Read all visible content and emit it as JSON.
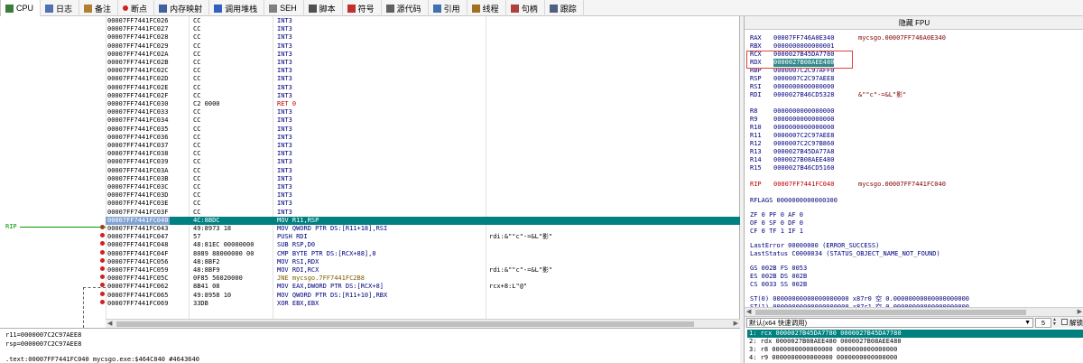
{
  "toolbar": {
    "tabs": [
      {
        "label": "CPU",
        "icon": "cpu-icon",
        "color": "#3a7d3a"
      },
      {
        "label": "日志",
        "icon": "log-icon",
        "color": "#5070b0"
      },
      {
        "label": "备注",
        "icon": "notes-icon",
        "color": "#b08030"
      },
      {
        "label": "断点",
        "icon": "breakpoint-icon",
        "color": "#d02020"
      },
      {
        "label": "内存映射",
        "icon": "memory-map-icon",
        "color": "#4060a0"
      },
      {
        "label": "调用堆栈",
        "icon": "call-stack-icon",
        "color": "#3060c0"
      },
      {
        "label": "SEH",
        "icon": "seh-icon",
        "color": "#808080"
      },
      {
        "label": "脚本",
        "icon": "script-icon",
        "color": "#505050"
      },
      {
        "label": "符号",
        "icon": "symbols-icon",
        "color": "#c03030"
      },
      {
        "label": "源代码",
        "icon": "source-icon",
        "color": "#606060"
      },
      {
        "label": "引用",
        "icon": "references-icon",
        "color": "#4070b0"
      },
      {
        "label": "线程",
        "icon": "threads-icon",
        "color": "#a07020"
      },
      {
        "label": "句柄",
        "icon": "handles-icon",
        "color": "#b04040"
      },
      {
        "label": "跟踪",
        "icon": "trace-icon",
        "color": "#506080"
      }
    ]
  },
  "disasm": {
    "rip_label": "RIP",
    "rows": [
      {
        "addr": "00007FF7441FC026",
        "hex": "CC",
        "asm": "INT3",
        "cmt": ""
      },
      {
        "addr": "00007FF7441FC027",
        "hex": "CC",
        "asm": "INT3",
        "cmt": ""
      },
      {
        "addr": "00007FF7441FC028",
        "hex": "CC",
        "asm": "INT3",
        "cmt": ""
      },
      {
        "addr": "00007FF7441FC029",
        "hex": "CC",
        "asm": "INT3",
        "cmt": ""
      },
      {
        "addr": "00007FF7441FC02A",
        "hex": "CC",
        "asm": "INT3",
        "cmt": ""
      },
      {
        "addr": "00007FF7441FC02B",
        "hex": "CC",
        "asm": "INT3",
        "cmt": ""
      },
      {
        "addr": "00007FF7441FC02C",
        "hex": "CC",
        "asm": "INT3",
        "cmt": ""
      },
      {
        "addr": "00007FF7441FC02D",
        "hex": "CC",
        "asm": "INT3",
        "cmt": ""
      },
      {
        "addr": "00007FF7441FC02E",
        "hex": "CC",
        "asm": "INT3",
        "cmt": ""
      },
      {
        "addr": "00007FF7441FC02F",
        "hex": "CC",
        "asm": "INT3",
        "cmt": ""
      },
      {
        "addr": "00007FF7441FC030",
        "hex": "C2 0000",
        "asm": "RET 0",
        "cmt": "",
        "kind": "ret"
      },
      {
        "addr": "00007FF7441FC033",
        "hex": "CC",
        "asm": "INT3",
        "cmt": ""
      },
      {
        "addr": "00007FF7441FC034",
        "hex": "CC",
        "asm": "INT3",
        "cmt": ""
      },
      {
        "addr": "00007FF7441FC035",
        "hex": "CC",
        "asm": "INT3",
        "cmt": ""
      },
      {
        "addr": "00007FF7441FC036",
        "hex": "CC",
        "asm": "INT3",
        "cmt": ""
      },
      {
        "addr": "00007FF7441FC037",
        "hex": "CC",
        "asm": "INT3",
        "cmt": ""
      },
      {
        "addr": "00007FF7441FC038",
        "hex": "CC",
        "asm": "INT3",
        "cmt": ""
      },
      {
        "addr": "00007FF7441FC039",
        "hex": "CC",
        "asm": "INT3",
        "cmt": ""
      },
      {
        "addr": "00007FF7441FC03A",
        "hex": "CC",
        "asm": "INT3",
        "cmt": ""
      },
      {
        "addr": "00007FF7441FC03B",
        "hex": "CC",
        "asm": "INT3",
        "cmt": ""
      },
      {
        "addr": "00007FF7441FC03C",
        "hex": "CC",
        "asm": "INT3",
        "cmt": ""
      },
      {
        "addr": "00007FF7441FC03D",
        "hex": "CC",
        "asm": "INT3",
        "cmt": ""
      },
      {
        "addr": "00007FF7441FC03E",
        "hex": "CC",
        "asm": "INT3",
        "cmt": ""
      },
      {
        "addr": "00007FF7441FC03F",
        "hex": "CC",
        "asm": "INT3",
        "cmt": ""
      },
      {
        "addr": "00007FF7441FC040",
        "hex": "4C:8BDC",
        "asm": "MOV R11,RSP",
        "cmt": "",
        "kind": "current"
      },
      {
        "addr": "00007FF7441FC043",
        "hex": "49:8973 18",
        "asm": "MOV QWORD PTR DS:[R11+18],RSI",
        "cmt": ""
      },
      {
        "addr": "00007FF7441FC047",
        "hex": "57",
        "asm": "PUSH RDI",
        "cmt": "rdi:&\"\"c\"-=&L\"影\""
      },
      {
        "addr": "00007FF7441FC048",
        "hex": "48:81EC 00000000",
        "asm": "SUB RSP,D0",
        "cmt": ""
      },
      {
        "addr": "00007FF7441FC04F",
        "hex": "8089 88000000 00",
        "asm": "CMP BYTE PTR DS:[RCX+88],0",
        "cmt": ""
      },
      {
        "addr": "00007FF7441FC056",
        "hex": "48:8BF2",
        "asm": "MOV RSI,RDX",
        "cmt": ""
      },
      {
        "addr": "00007FF7441FC059",
        "hex": "48:8BF9",
        "asm": "MOV RDI,RCX",
        "cmt": "rdi:&\"\"c\"-=&L\"影\""
      },
      {
        "addr": "00007FF7441FC05C",
        "hex": "0F85 56020000",
        "asm": "JNE mycsgo.7FF7441FC2B8",
        "cmt": "",
        "kind": "jmp"
      },
      {
        "addr": "00007FF7441FC062",
        "hex": "8B41 08",
        "asm": "MOV EAX,DWORD PTR DS:[RCX+8]",
        "cmt": "rcx+8:L\"@\""
      },
      {
        "addr": "00007FF7441FC065",
        "hex": "49:8958 10",
        "asm": "MOV QWORD PTR DS:[R11+10],RBX",
        "cmt": ""
      },
      {
        "addr": "00007FF7441FC069",
        "hex": "33DB",
        "asm": "XOR EBX,EBX",
        "cmt": ""
      }
    ]
  },
  "info": {
    "line1": "r11=0000007C2C97AEE8",
    "line2": "rsp=0000007C2C97AEE8",
    "line3": ".text:00007FF7441FC040 mycsgo.exe:$464C040 #4643640"
  },
  "regs": {
    "title": "隐藏 FPU",
    "list": [
      {
        "name": "RAX",
        "value": "00007FF746A0E340",
        "info": "mycsgo.00007FF746A0E340"
      },
      {
        "name": "RBX",
        "value": "0000000000000001",
        "info": ""
      },
      {
        "name": "RCX",
        "value": "0000027B45DA7780",
        "info": ""
      },
      {
        "name": "RDX",
        "value": "0000027B08AEE480",
        "info": "",
        "hl": true
      },
      {
        "name": "RBP",
        "value": "0000007C2C97AFF0",
        "info": ""
      },
      {
        "name": "RSP",
        "value": "0000007C2C97AEE8",
        "info": ""
      },
      {
        "name": "RSI",
        "value": "0000000000000000",
        "info": ""
      },
      {
        "name": "RDI",
        "value": "0000027B46CD5328",
        "info": "&\"\"c\"-=&L\"影\""
      },
      {
        "name": "R8",
        "value": "0000000000000000",
        "info": "",
        "gap": true
      },
      {
        "name": "R9",
        "value": "0000000000000000",
        "info": ""
      },
      {
        "name": "R10",
        "value": "0000000000000000",
        "info": ""
      },
      {
        "name": "R11",
        "value": "0000007C2C97AEE8",
        "info": ""
      },
      {
        "name": "R12",
        "value": "0000007C2C97B860",
        "info": ""
      },
      {
        "name": "R13",
        "value": "0000027B45DA77A8",
        "info": ""
      },
      {
        "name": "R14",
        "value": "0000027B08AEE480",
        "info": ""
      },
      {
        "name": "R15",
        "value": "0000027B46CD5160",
        "info": ""
      },
      {
        "name": "RIP",
        "value": "00007FF7441FC040",
        "info": "mycsgo.00007FF7441FC040",
        "gap": true,
        "red": true
      }
    ],
    "rflags": "RFLAGS   0000000000000300",
    "flags1": "ZF 0   PF 0   AF 0",
    "flags2": "OF 0   SF 0   DF 0",
    "flags3": "CF 0   TF 1   IF 1",
    "lasterror": "LastError  00000000 (ERROR_SUCCESS)",
    "laststatus": "LastStatus C0000034 (STATUS_OBJECT_NAME_NOT_FOUND)",
    "seg1": "GS 002B   FS 0053",
    "seg2": "ES 002B   DS 002B",
    "seg3": "CS 0033   SS 002B",
    "st0": "ST(0) 00000000000000000000 x87r0 空 0.00000000000000000000",
    "st1": "ST(1) 00000000000000000000 x87r1 空 0.00000000000000000000"
  },
  "callbar": {
    "convention": "默认(x64 快速调用)",
    "count": "5",
    "unlock_label": "解锁"
  },
  "args": [
    "1: rcx 0000027B45DA7780 0000027B45DA7780",
    "2: rdx 0000027B08AEE480 0000027B08AEE480",
    "3: r8 0000000000000000 0000000000000000",
    "4: r9 0000000000000000 0000000000000000"
  ]
}
